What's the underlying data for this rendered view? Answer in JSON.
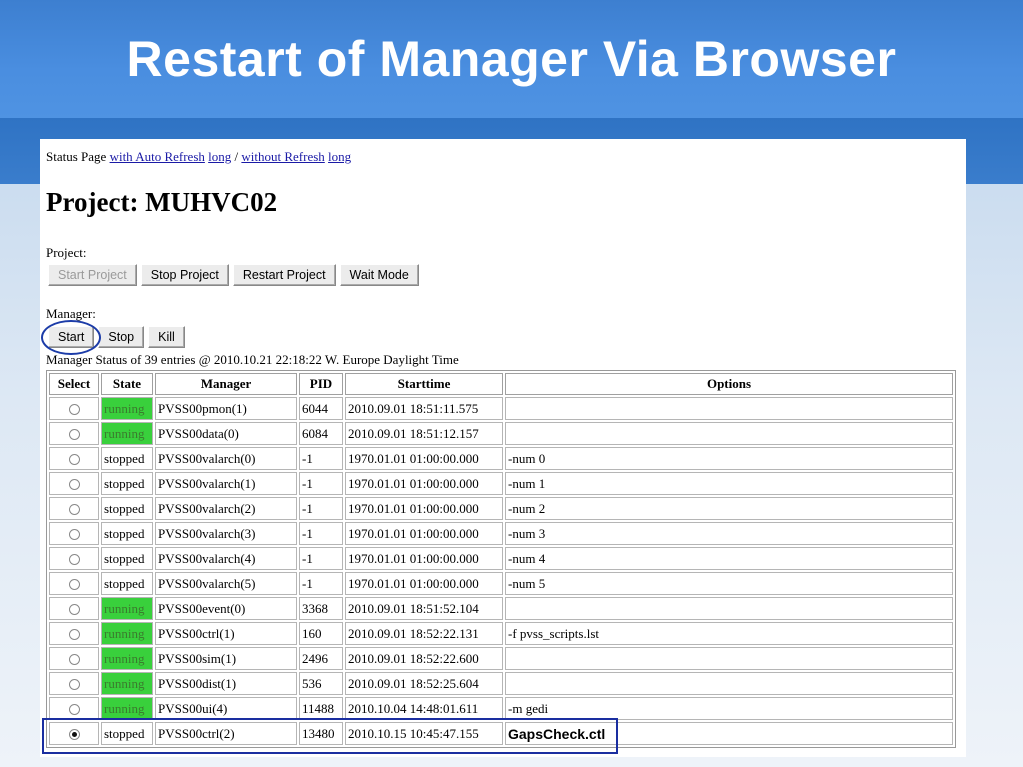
{
  "slide": {
    "title": "Restart of Manager Via Browser"
  },
  "status_line": {
    "prefix": "Status Page",
    "link_auto_refresh": "with Auto Refresh",
    "link_long_1": "long",
    "separator": "/",
    "link_without_refresh": "without Refresh",
    "link_long_2": "long"
  },
  "project_heading": "Project: MUHVC02",
  "project_section": {
    "label": "Project:",
    "buttons": [
      "Start Project",
      "Stop Project",
      "Restart Project",
      "Wait Mode"
    ]
  },
  "manager_section": {
    "label": "Manager:",
    "buttons": [
      "Start",
      "Stop",
      "Kill"
    ]
  },
  "manager_status": "Manager Status of 39 entries @ 2010.10.21 22:18:22 W. Europe Daylight Time",
  "table": {
    "headers": [
      "Select",
      "State",
      "Manager",
      "PID",
      "Starttime",
      "Options"
    ],
    "rows": [
      {
        "selected": false,
        "state": "running",
        "manager": "PVSS00pmon(1)",
        "pid": "6044",
        "start": "2010.09.01 18:51:11.575",
        "options": ""
      },
      {
        "selected": false,
        "state": "running",
        "manager": "PVSS00data(0)",
        "pid": "6084",
        "start": "2010.09.01 18:51:12.157",
        "options": ""
      },
      {
        "selected": false,
        "state": "stopped",
        "manager": "PVSS00valarch(0)",
        "pid": "-1",
        "start": "1970.01.01 01:00:00.000",
        "options": "-num 0"
      },
      {
        "selected": false,
        "state": "stopped",
        "manager": "PVSS00valarch(1)",
        "pid": "-1",
        "start": "1970.01.01 01:00:00.000",
        "options": "-num 1"
      },
      {
        "selected": false,
        "state": "stopped",
        "manager": "PVSS00valarch(2)",
        "pid": "-1",
        "start": "1970.01.01 01:00:00.000",
        "options": "-num 2"
      },
      {
        "selected": false,
        "state": "stopped",
        "manager": "PVSS00valarch(3)",
        "pid": "-1",
        "start": "1970.01.01 01:00:00.000",
        "options": "-num 3"
      },
      {
        "selected": false,
        "state": "stopped",
        "manager": "PVSS00valarch(4)",
        "pid": "-1",
        "start": "1970.01.01 01:00:00.000",
        "options": "-num 4"
      },
      {
        "selected": false,
        "state": "stopped",
        "manager": "PVSS00valarch(5)",
        "pid": "-1",
        "start": "1970.01.01 01:00:00.000",
        "options": "-num 5"
      },
      {
        "selected": false,
        "state": "running",
        "manager": "PVSS00event(0)",
        "pid": "3368",
        "start": "2010.09.01 18:51:52.104",
        "options": ""
      },
      {
        "selected": false,
        "state": "running",
        "manager": "PVSS00ctrl(1)",
        "pid": "160",
        "start": "2010.09.01 18:52:22.131",
        "options": "-f pvss_scripts.lst"
      },
      {
        "selected": false,
        "state": "running",
        "manager": "PVSS00sim(1)",
        "pid": "2496",
        "start": "2010.09.01 18:52:22.600",
        "options": ""
      },
      {
        "selected": false,
        "state": "running",
        "manager": "PVSS00dist(1)",
        "pid": "536",
        "start": "2010.09.01 18:52:25.604",
        "options": ""
      },
      {
        "selected": false,
        "state": "running",
        "manager": "PVSS00ui(4)",
        "pid": "11488",
        "start": "2010.10.04 14:48:01.611",
        "options": "-m gedi"
      },
      {
        "selected": true,
        "state": "stopped",
        "manager": "PVSS00ctrl(2)",
        "pid": "13480",
        "start": "2010.10.15 10:45:47.155",
        "options": "GapsCheck.ctl"
      }
    ]
  },
  "colors": {
    "title_bar": "#4a8ee0",
    "running_bg": "#39d03c",
    "annotation": "#1a2ea0",
    "link": "#1a1aa6"
  }
}
